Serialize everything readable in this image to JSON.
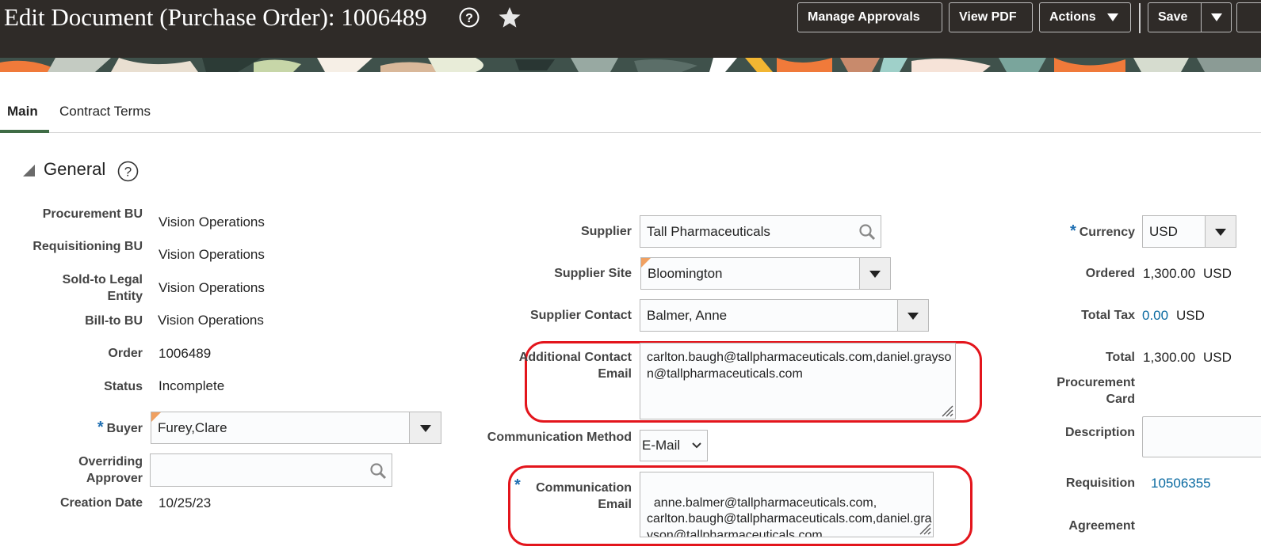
{
  "header": {
    "title": "Edit Document (Purchase Order): 1006489",
    "help_icon": "help-circle-icon",
    "favorite_icon": "star-icon",
    "buttons": {
      "manage_approvals": "Manage Approvals",
      "view_pdf": "View PDF",
      "actions": "Actions",
      "save": "Save"
    }
  },
  "tabs": [
    {
      "label": "Main",
      "active": true
    },
    {
      "label": "Contract Terms",
      "active": false
    }
  ],
  "section": {
    "title": "General",
    "collapse_icon": "triangle-collapse-icon",
    "help_icon": "help-circle-icon"
  },
  "left": {
    "procurement_bu": {
      "label": "Procurement BU",
      "value": "Vision Operations"
    },
    "requisitioning_bu": {
      "label": "Requisitioning BU",
      "value": "Vision Operations"
    },
    "sold_to": {
      "label": "Sold-to Legal Entity",
      "value": "Vision Operations"
    },
    "bill_to": {
      "label": "Bill-to BU",
      "value": "Vision Operations"
    },
    "order": {
      "label": "Order",
      "value": "1006489"
    },
    "status": {
      "label": "Status",
      "value": "Incomplete"
    },
    "buyer": {
      "label": "Buyer",
      "value": "Furey,Clare",
      "required": true
    },
    "overriding_approver": {
      "label": "Overriding Approver",
      "value": ""
    },
    "creation_date": {
      "label": "Creation Date",
      "value": "10/25/23"
    }
  },
  "middle": {
    "supplier": {
      "label": "Supplier",
      "value": "Tall Pharmaceuticals"
    },
    "supplier_site": {
      "label": "Supplier Site",
      "value": "Bloomington"
    },
    "supplier_contact": {
      "label": "Supplier Contact",
      "value": "Balmer, Anne"
    },
    "additional_contact_email": {
      "label": "Additional Contact Email",
      "value": "carlton.baugh@tallpharmaceuticals.com,daniel.grayson@tallpharmaceuticals.com"
    },
    "communication_method": {
      "label": "Communication Method",
      "value": "E-Mail"
    },
    "communication_email": {
      "label": "Communication Email",
      "required": true,
      "value": "anne.balmer@tallpharmaceuticals.com,\ncarlton.baugh@tallpharmaceuticals.com,daniel.grayson@tallpharmaceuticals.com"
    }
  },
  "right": {
    "currency": {
      "label": "Currency",
      "value": "USD",
      "required": true
    },
    "ordered": {
      "label": "Ordered",
      "value": "1,300.00",
      "unit": "USD"
    },
    "total_tax": {
      "label": "Total Tax",
      "value": "0.00",
      "unit": "USD"
    },
    "total": {
      "label": "Total",
      "value": "1,300.00",
      "unit": "USD"
    },
    "procurement_card": {
      "label": "Procurement Card"
    },
    "description": {
      "label": "Description",
      "value": ""
    },
    "requisition": {
      "label": "Requisition",
      "value": "10506355"
    },
    "agreement": {
      "label": "Agreement"
    }
  },
  "colors": {
    "highlight": "#e3151c",
    "link": "#0a6aa1",
    "header_bg": "#2f2b28",
    "tab_active": "#3f6c45"
  }
}
